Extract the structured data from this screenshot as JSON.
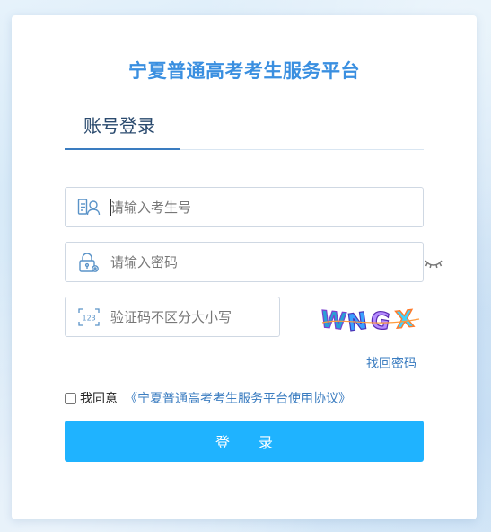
{
  "page": {
    "title": "宁夏普通高考考生服务平台"
  },
  "tabs": {
    "active_label": "账号登录"
  },
  "form": {
    "username_placeholder": "请输入考生号",
    "password_placeholder": "请输入密码",
    "captcha_placeholder": "验证码不区分大小写",
    "captcha_text": "WNGX",
    "forgot_label": "找回密码",
    "agree_label": "我同意",
    "agreement_link": "《宁夏普通高考考生服务平台使用协议》",
    "login_label": "登录"
  },
  "colors": {
    "title": "#3a8fe0",
    "button": "#1fb3ff",
    "link": "#3a7cc0"
  },
  "icons": [
    "user-id-icon",
    "lock-icon",
    "captcha-code-icon",
    "eye-closed-icon"
  ]
}
